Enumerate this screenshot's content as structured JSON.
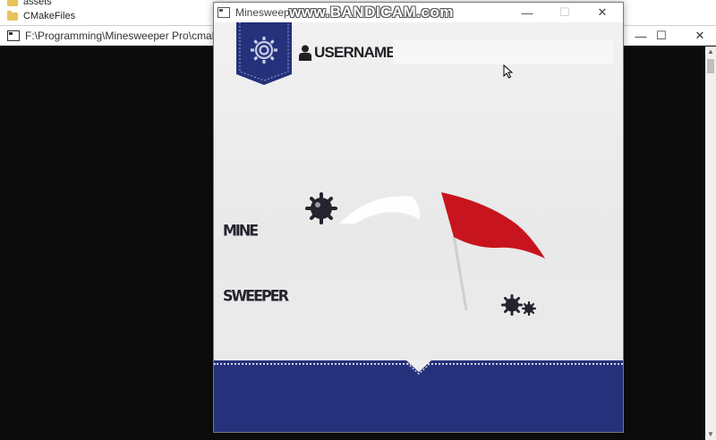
{
  "explorer": {
    "items": [
      {
        "label": "assets",
        "icon": "folder-icon"
      },
      {
        "label": "CMakeFiles",
        "icon": "folder-icon"
      }
    ]
  },
  "console": {
    "title": "F:\\Programming\\Minesweeper Pro\\cmake-b",
    "controls": {
      "minimize": "—",
      "maximize": "☐",
      "close": "✕"
    }
  },
  "game": {
    "title": "Minesweeper",
    "watermark": "www.BANDICAM.com",
    "controls": {
      "minimize": "—",
      "maximize": "☐",
      "close": "✕"
    },
    "username": {
      "label": "USERNAME:",
      "value": "",
      "placeholder": ""
    },
    "logo": {
      "line1": "MINE",
      "line2": "SWEEPER"
    },
    "colors": {
      "banner_blue": "#25317a",
      "flag_red": "#c8141e",
      "text_dark": "#25232d",
      "background": "#ededed"
    }
  }
}
